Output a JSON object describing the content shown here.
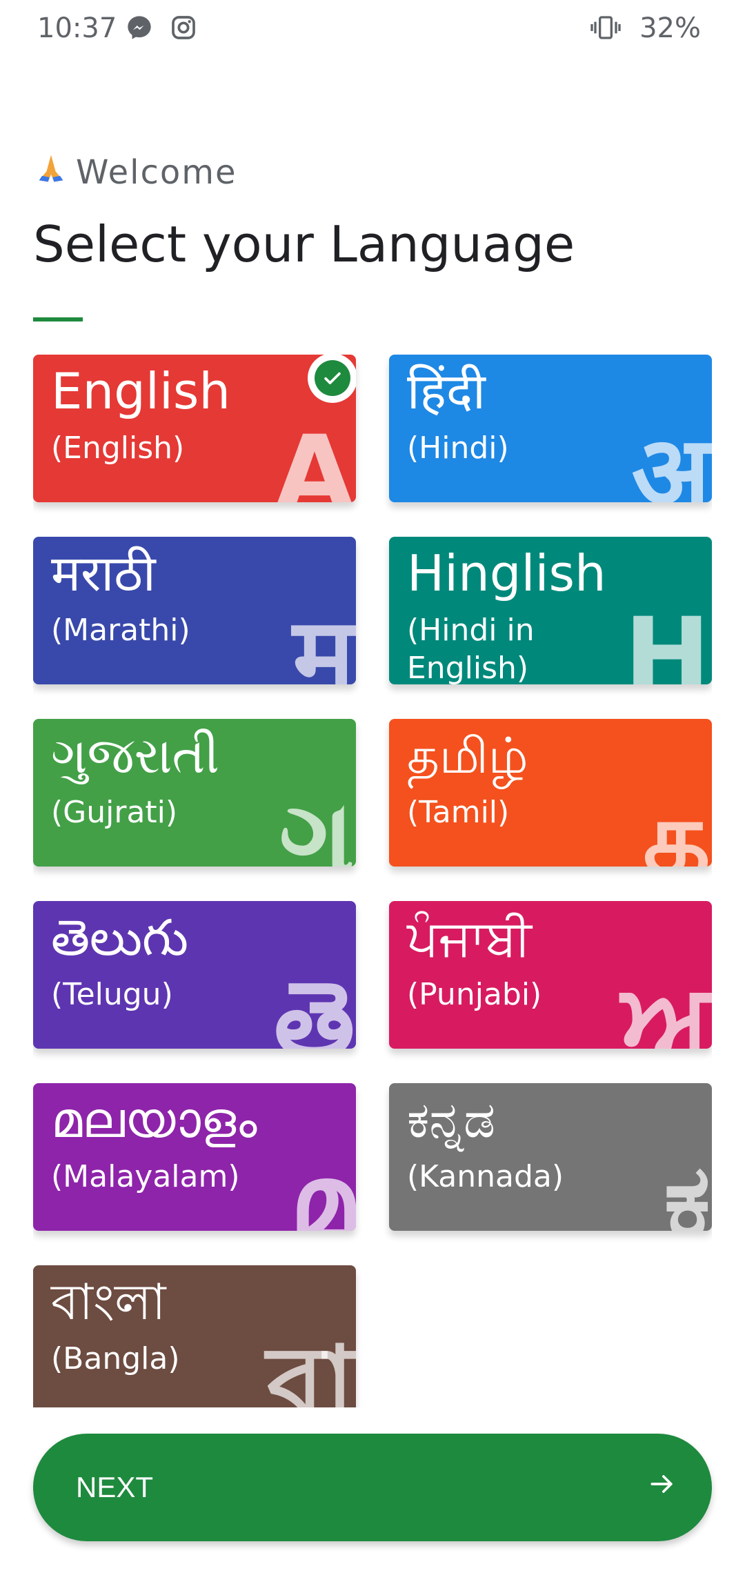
{
  "status_bar": {
    "time": "10:37",
    "battery": "32%",
    "icons": [
      "messenger-icon",
      "instagram-icon",
      "vibrate-icon"
    ]
  },
  "header": {
    "welcome": "Welcome",
    "welcome_icon": "folded-hands-icon",
    "title": "Select your Language",
    "accent": "#1e8a3e"
  },
  "languages": [
    {
      "native": "English",
      "english": "(English)",
      "letter": "A",
      "color": "#e53935",
      "selected": true
    },
    {
      "native": "हिंदी",
      "english": "(Hindi)",
      "letter": "अ",
      "color": "#1e88e5",
      "selected": false
    },
    {
      "native": "मराठी",
      "english": "(Marathi)",
      "letter": "म",
      "color": "#3949ab",
      "selected": false
    },
    {
      "native": "Hinglish",
      "english": "(Hindi in English)",
      "letter": "H",
      "color": "#00897b",
      "selected": false
    },
    {
      "native": "ગુજરાતી",
      "english": "(Gujrati)",
      "letter": "ગુ",
      "color": "#43a047",
      "selected": false
    },
    {
      "native": "தமிழ்",
      "english": "(Tamil)",
      "letter": "த",
      "color": "#f4511e",
      "selected": false
    },
    {
      "native": "తెలుగు",
      "english": "(Telugu)",
      "letter": "తె",
      "color": "#5e35b1",
      "selected": false
    },
    {
      "native": "ਪੰਜਾਬੀ",
      "english": "(Punjabi)",
      "letter": "ਅ",
      "color": "#d81b60",
      "selected": false
    },
    {
      "native": "മലയാളം",
      "english": "(Malayalam)",
      "letter": "മ",
      "color": "#8e24aa",
      "selected": false
    },
    {
      "native": "ಕನ್ನಡ",
      "english": "(Kannada)",
      "letter": "ಕ",
      "color": "#757575",
      "selected": false
    },
    {
      "native": "বাংলা",
      "english": "(Bangla)",
      "letter": "বা",
      "color": "#6d4c41",
      "selected": false
    }
  ],
  "next_button": {
    "label": "NEXT",
    "icon": "arrow-right-icon",
    "color": "#1e8a3e"
  }
}
